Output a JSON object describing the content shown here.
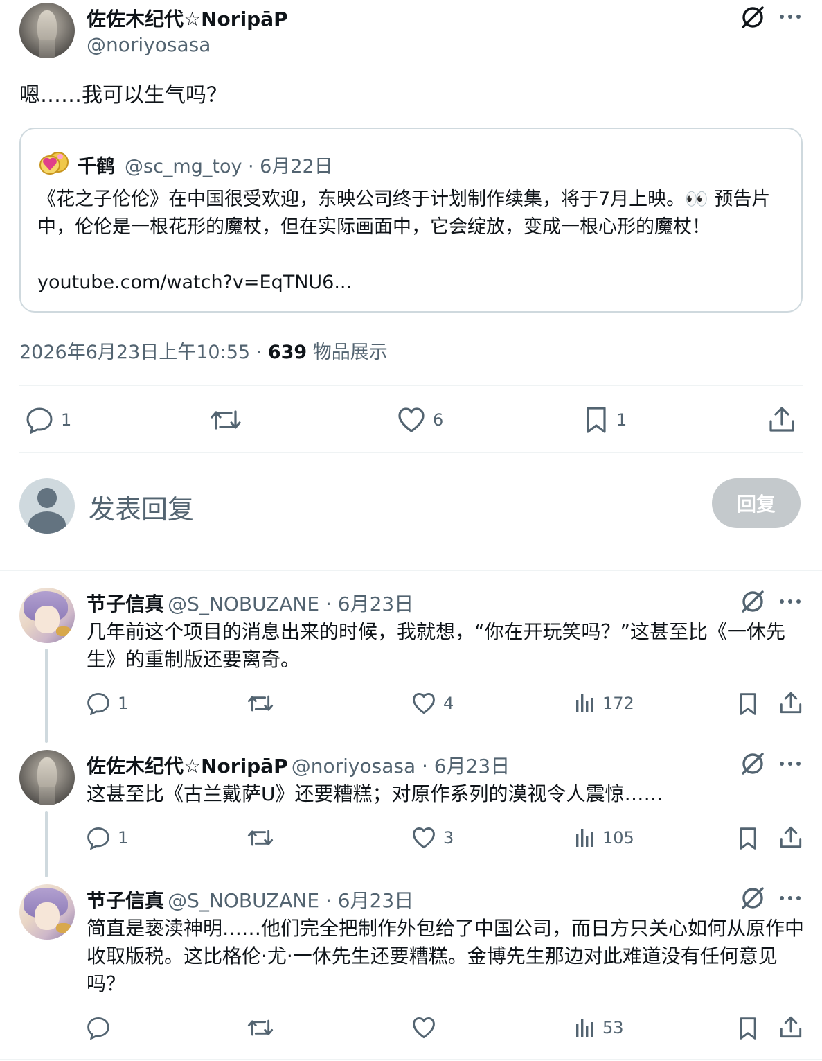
{
  "main_post": {
    "author_name": "佐佐木纪代☆NoripāP",
    "author_handle": "@noriyosasa",
    "text": "嗯……我可以生气吗？",
    "quote": {
      "author_name": "千鹤",
      "meta": "@sc_mg_toy · 6月22日",
      "text": "《花之子伦伦》在中国很受欢迎，东映公司终于计划制作续集，将于7月上映。👀 预告片中，伦伦是一根花形的魔杖，但在实际画面中，它会绽放，变成一根心形的魔杖！",
      "link": "youtube.com/watch?v=EqTNU6..."
    },
    "timestamp": "2026年6月23日上午10:55 ·",
    "views_count": "639",
    "views_label": "物品展示",
    "stats": {
      "replies": "1",
      "likes": "6",
      "bookmarks": "1"
    }
  },
  "compose": {
    "placeholder": "发表回复",
    "button_label": "回复"
  },
  "replies": [
    {
      "author_name": "节子信真",
      "meta": "@S_NOBUZANE · 6月23日",
      "text": "几年前这个项目的消息出来的时候，我就想，“你在开玩笑吗？”这甚至比《一休先生》的重制版还要离奇。",
      "replies": "1",
      "likes": "4",
      "views": "172"
    },
    {
      "author_name": "佐佐木纪代☆NoripāP",
      "meta": "@noriyosasa · 6月23日",
      "text": "这甚至比《古兰戴萨U》还要糟糕；对原作系列的漠视令人震惊……",
      "replies": "1",
      "likes": "3",
      "views": "105"
    },
    {
      "author_name": "节子信真",
      "meta": "@S_NOBUZANE · 6月23日",
      "text": "简直是亵渎神明……他们完全把制作外包给了中国公司，而日方只关心如何从原作中收取版税。这比格伦·尤·一休先生还要糟糕。金博先生那边对此难道没有任何意见吗？",
      "replies": "",
      "likes": "",
      "views": "53"
    }
  ]
}
